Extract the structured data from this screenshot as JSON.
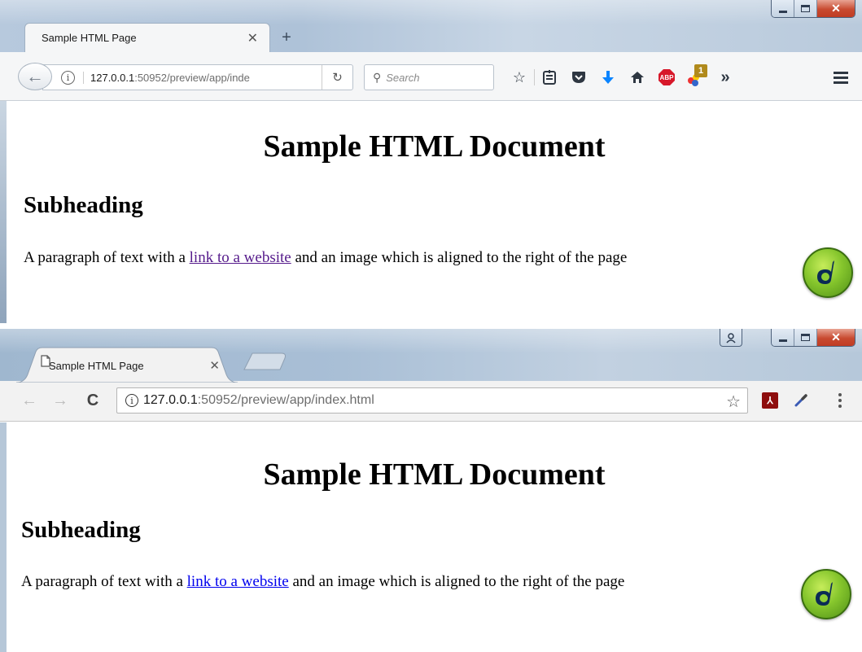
{
  "firefox": {
    "tab_title": "Sample HTML Page",
    "url_host": "127.0.0.1",
    "url_rest": ":50952/preview/app/inde",
    "search_placeholder": "Search",
    "addon_badge_count": "1",
    "abp_label": "ABP",
    "overflow_label": "»",
    "toolbar_icons": [
      "star-icon",
      "reading-list-icon",
      "pocket-icon",
      "download-icon",
      "home-icon",
      "adblock-icon",
      "addon-badge-icon",
      "overflow-icon",
      "menu-icon"
    ]
  },
  "chrome": {
    "tab_title": "Sample HTML Page",
    "url_host": "127.0.0.1",
    "url_rest": ":50952/preview/app/index.html",
    "extension_icons": [
      "star-icon",
      "pdf-icon",
      "eyedropper-icon",
      "kebab-menu-icon"
    ]
  },
  "page": {
    "heading": "Sample HTML Document",
    "subheading": "Subheading",
    "paragraph_before": "A paragraph of text with a ",
    "link_text": "link to a website",
    "paragraph_after": " and an image which is aligned to the right of the page",
    "image_alt": "Dreamweaver logo"
  },
  "colors": {
    "link_visited": "#551a8b",
    "link_unvisited": "#0000ee",
    "firefox_download_blue": "#0a84ff",
    "abp_red": "#d7182a"
  }
}
